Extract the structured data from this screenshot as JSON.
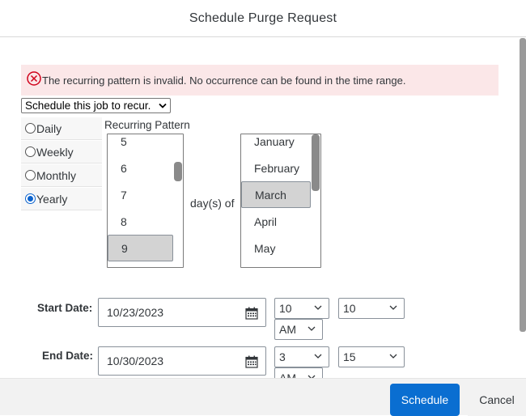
{
  "dialog": {
    "title": "Schedule Purge Request"
  },
  "error": {
    "message": "The recurring pattern is invalid. No occurrence can be found in the time range."
  },
  "recurrence": {
    "select_value": "Schedule this job to recur.",
    "pattern_label": "Recurring Pattern",
    "frequencies": [
      {
        "label": "Daily",
        "checked": false
      },
      {
        "label": "Weekly",
        "checked": false
      },
      {
        "label": "Monthly",
        "checked": false
      },
      {
        "label": "Yearly",
        "checked": true
      }
    ],
    "days": [
      "5",
      "6",
      "7",
      "8",
      "9"
    ],
    "selected_day": "9",
    "day_of_label": "day(s) of",
    "months": [
      "January",
      "February",
      "March",
      "April",
      "May"
    ],
    "selected_month": "March"
  },
  "start": {
    "label": "Start Date:",
    "date": "10/23/2023",
    "hour": "10",
    "minute": "10",
    "ampm": "AM"
  },
  "end": {
    "label": "End Date:",
    "date": "10/30/2023",
    "hour": "3",
    "minute": "15",
    "ampm": "AM"
  },
  "footer": {
    "schedule_label": "Schedule",
    "cancel_label": "Cancel"
  },
  "colors": {
    "primary": "#0a6ed1",
    "error_bg": "#fbe7e8",
    "error_icon": "#d0021b"
  }
}
